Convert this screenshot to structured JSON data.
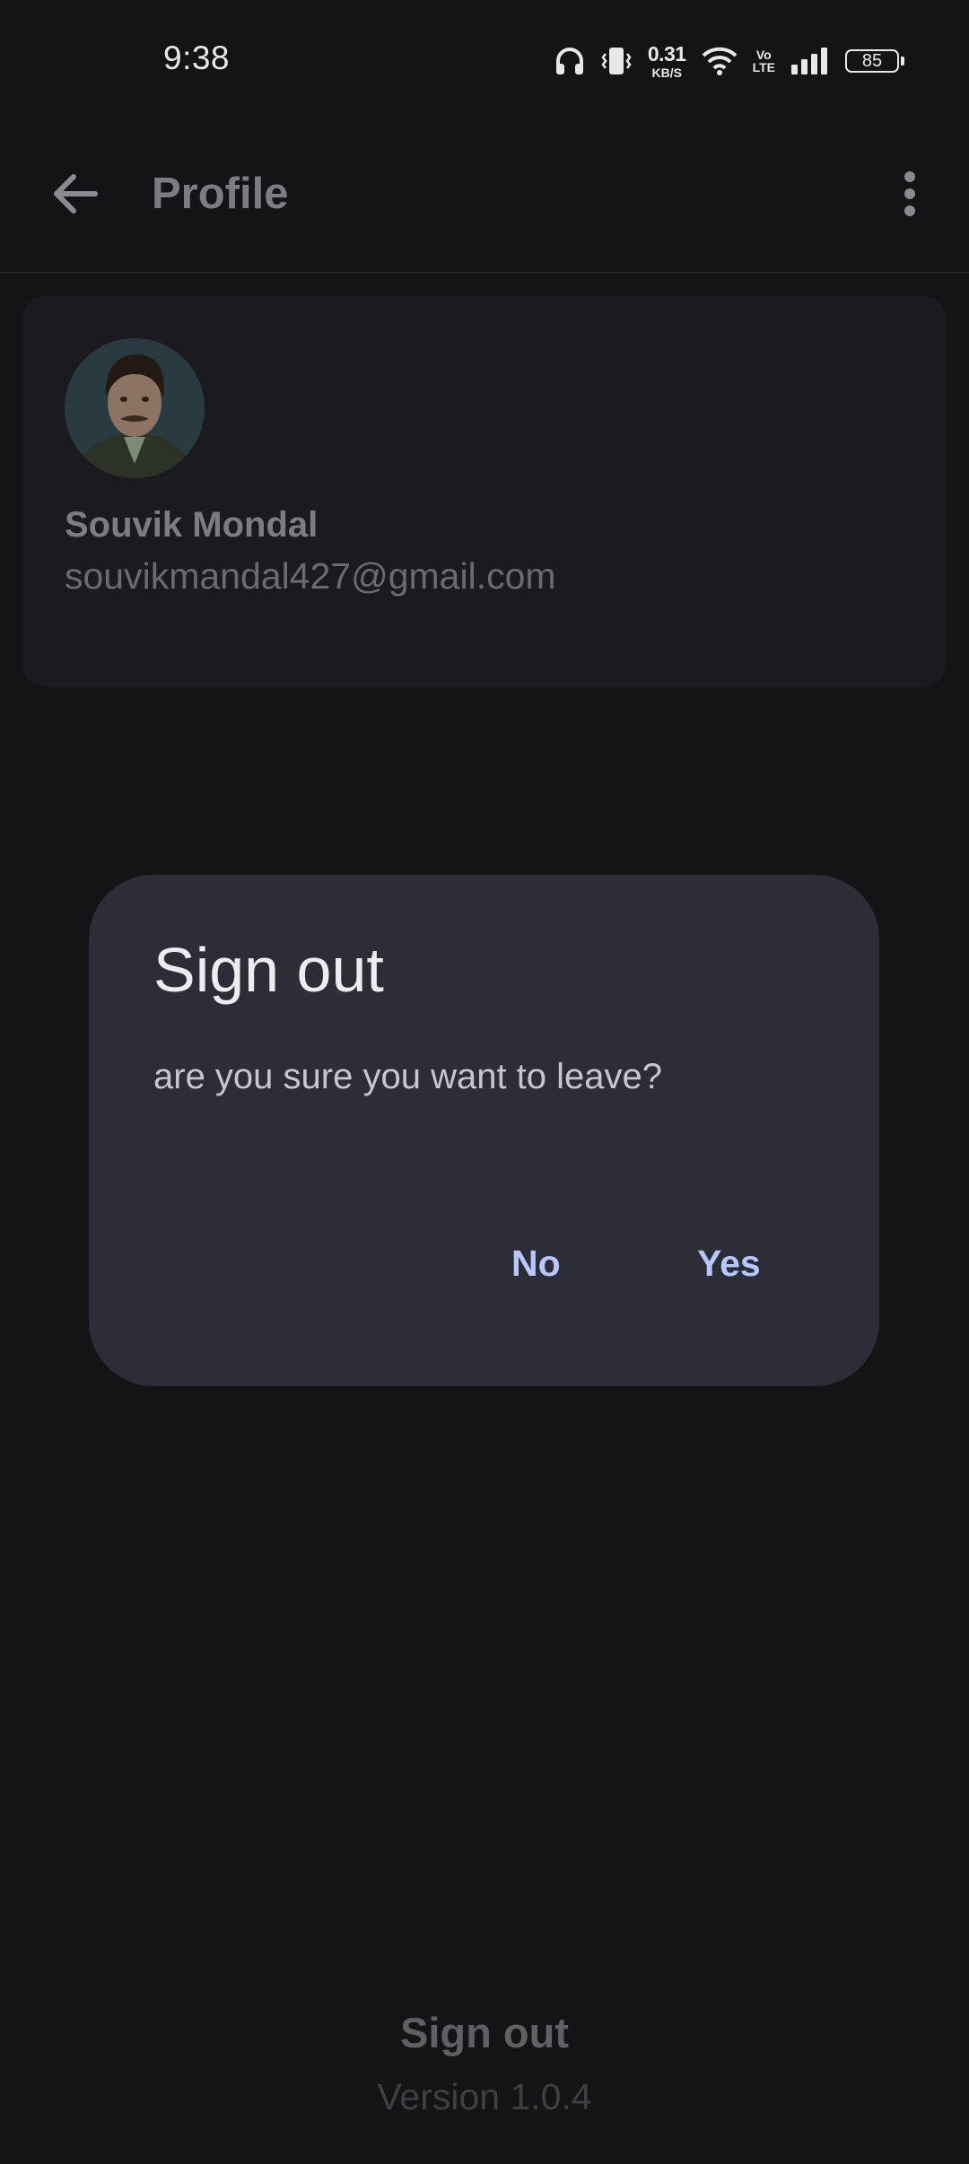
{
  "status_bar": {
    "time": "9:38",
    "net_speed_value": "0.31",
    "net_speed_unit": "KB/S",
    "volte_top": "Vo",
    "volte_bottom": "LTE",
    "battery_level": "85",
    "icons": [
      "headphones-icon",
      "vibrate-icon",
      "wifi-icon",
      "signal-icon",
      "battery-icon"
    ]
  },
  "app_bar": {
    "title": "Profile",
    "back_icon": "arrow-left-icon",
    "menu_icon": "more-vert-icon"
  },
  "profile": {
    "name": "Souvik Mondal",
    "email": "souvikmandal427@gmail.com"
  },
  "footer": {
    "sign_out_label": "Sign out",
    "version": "Version 1.0.4"
  },
  "dialog": {
    "title": "Sign out",
    "message": "are you sure you want to leave?",
    "no_label": "No",
    "yes_label": "Yes",
    "accent_color": "#b9c7ff",
    "background_color": "#2c2d37"
  },
  "colors": {
    "background": "#141417",
    "card": "#1b1b1f"
  }
}
